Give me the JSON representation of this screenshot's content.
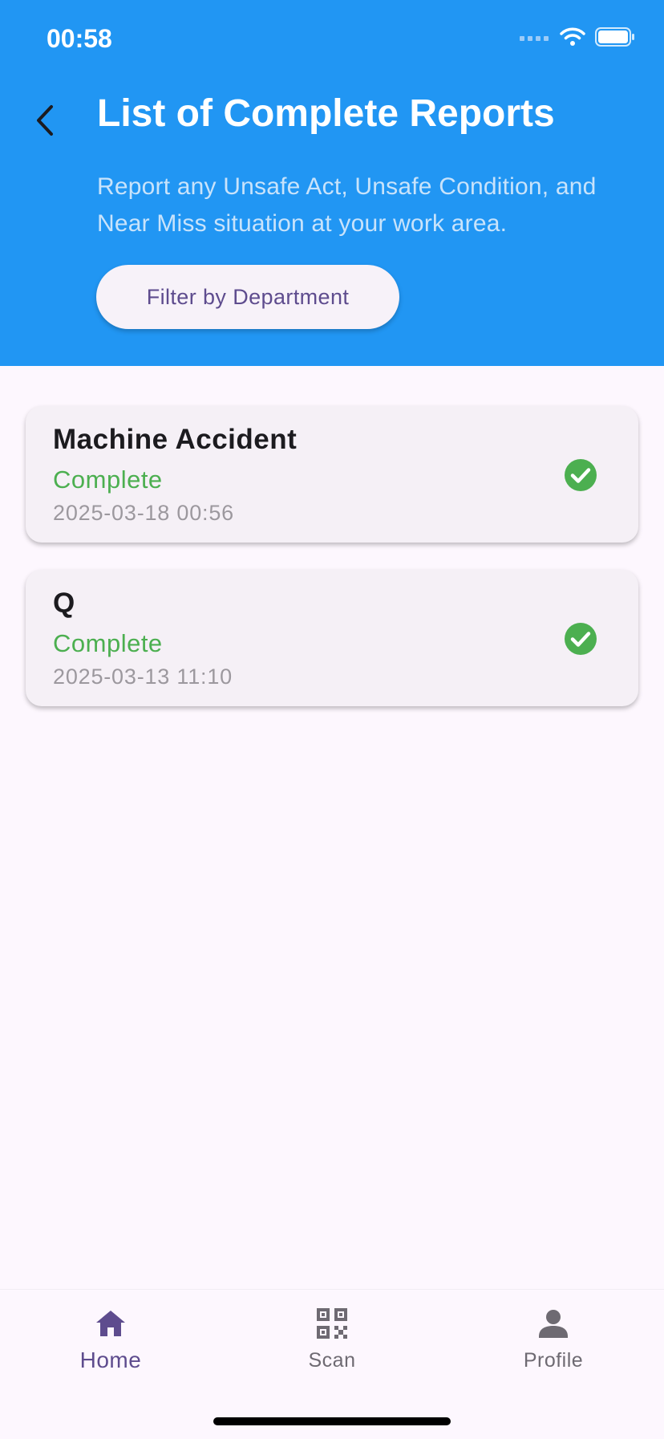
{
  "status_bar": {
    "time": "00:58",
    "icons": [
      "signal-icon",
      "wifi-icon",
      "battery-icon"
    ]
  },
  "header": {
    "back_icon": "chevron-left-icon",
    "title": "List of Complete Reports",
    "subtitle": "Report any Unsafe Act, Unsafe Condition, and Near Miss situation at your work area.",
    "filter_label": "Filter by Department",
    "background_color": "#2196F3"
  },
  "reports": [
    {
      "title": "Machine Accident",
      "status": "Complete",
      "date": "2025-03-18 00:56",
      "icon": "check-circle-icon"
    },
    {
      "title": "Q",
      "status": "Complete",
      "date": "2025-03-13 11:10",
      "icon": "check-circle-icon"
    }
  ],
  "status_color": "#4CAF50",
  "bottom_nav": {
    "items": [
      {
        "label": "Home",
        "icon": "home-icon",
        "active": true
      },
      {
        "label": "Scan",
        "icon": "qr-code-icon",
        "active": false
      },
      {
        "label": "Profile",
        "icon": "person-icon",
        "active": false
      }
    ],
    "active_color": "#5E4C8E"
  }
}
